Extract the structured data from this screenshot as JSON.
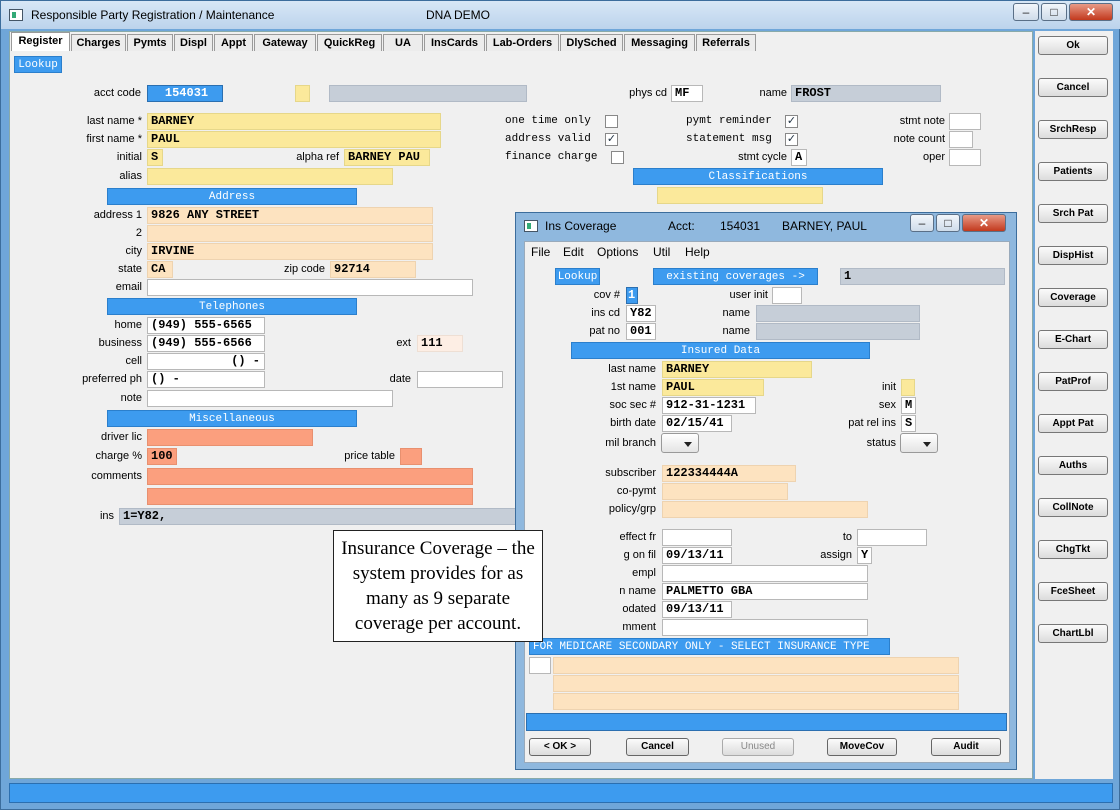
{
  "window": {
    "title": "Responsible Party Registration / Maintenance",
    "company": "DNA DEMO"
  },
  "tabs": [
    "Register",
    "Charges",
    "Pymts",
    "Displ",
    "Appt",
    "Gateway",
    "QuickReg",
    "UA",
    "InsCards",
    "Lab-Orders",
    "DlySched",
    "Messaging",
    "Referrals"
  ],
  "lookup_label": "Lookup",
  "account": {
    "acct_code_label": "acct code",
    "acct_code": "154031",
    "phys_cd_label": "phys cd",
    "phys_cd": "MF",
    "name_label": "name",
    "name": "FROST"
  },
  "patient": {
    "last_name_label": "last name *",
    "last_name": "BARNEY",
    "first_name_label": "first name *",
    "first_name": "PAUL",
    "initial_label": "initial",
    "initial": "S",
    "alpha_ref_label": "alpha ref",
    "alpha_ref": "BARNEY PAU",
    "alias_label": "alias",
    "alias": ""
  },
  "flags": {
    "one_time_only": "one time only",
    "address_valid": "address valid",
    "finance_charge": "finance charge",
    "pymt_reminder": "pymt reminder",
    "statement_msg": "statement msg",
    "stmt_cycle_label": "stmt cycle",
    "stmt_cycle": "A",
    "stmt_note_label": "stmt note",
    "note_count_label": "note count",
    "oper_label": "oper"
  },
  "sections": {
    "address": "Address",
    "telephones": "Telephones",
    "miscellaneous": "Miscellaneous",
    "classifications": "Classifications"
  },
  "address": {
    "address1_label": "address 1",
    "address1": "9826 ANY STREET",
    "address2_label": "2",
    "city_label": "city",
    "city": "IRVINE",
    "state_label": "state",
    "state": "CA",
    "zip_label": "zip code",
    "zip": "92714",
    "email_label": "email"
  },
  "phones": {
    "home_label": "home",
    "home": "(949) 555-6565",
    "business_label": "business",
    "business": "(949) 555-6566",
    "ext_label": "ext",
    "ext": "111",
    "cell_label": "cell",
    "cell": "() -",
    "preferred_label": "preferred ph",
    "preferred": "() -",
    "date_label": "date",
    "note_label": "note"
  },
  "misc": {
    "driver_lic_label": "driver lic",
    "charge_label": "charge %",
    "charge": "100",
    "price_table_label": "price table",
    "comments_label": "comments",
    "ins_label": "ins",
    "ins": "1=Y82,"
  },
  "side_buttons": [
    "Ok",
    "Cancel",
    "SrchResp",
    "Patients",
    "Srch Pat",
    "DispHist",
    "Coverage",
    "E-Chart",
    "PatProf",
    "Appt Pat",
    "Auths",
    "CollNote",
    "ChgTkt",
    "FceSheet",
    "ChartLbl"
  ],
  "ins_window": {
    "title": "Ins Coverage",
    "acct_label": "Acct:",
    "acct": "154031",
    "acct_name": "BARNEY, PAUL",
    "menu": [
      "File",
      "Edit",
      "Options",
      "Util",
      "Help"
    ],
    "lookup": "Lookup",
    "existing_coverages": "existing coverages ->",
    "existing_count": "1",
    "cov_label": "cov #",
    "cov": "1",
    "user_init_label": "user init",
    "ins_cd_label": "ins cd",
    "ins_cd": "Y82",
    "ins_name_label": "name",
    "pat_no_label": "pat no",
    "pat_no": "001",
    "pat_name_label": "name",
    "insured_data": "Insured Data",
    "last_name_label": "last name",
    "last_name": "BARNEY",
    "first_name_label": "1st name",
    "first_name": "PAUL",
    "init_label": "init",
    "soc_sec_label": "soc sec #",
    "soc_sec": "912-31-1231",
    "sex_label": "sex",
    "sex": "M",
    "birth_label": "birth date",
    "birth": "02/15/41",
    "pat_rel_label": "pat rel ins",
    "pat_rel": "S",
    "mil_branch_label": "mil branch",
    "status_label": "status",
    "subscriber_label": "subscriber",
    "subscriber": "122334444A",
    "co_pymt_label": "co-pymt",
    "policy_label": "policy/grp",
    "effect_label": "effect fr",
    "to_label": "to",
    "sig_on_file_label": "g on fil",
    "sig_on_file": "09/13/11",
    "assign_label": "assign",
    "assign": "Y",
    "empl_label": "empl",
    "plan_name_label": "n name",
    "plan_name": "PALMETTO GBA",
    "updated_label": "odated",
    "updated": "09/13/11",
    "comment_label": "mment",
    "medicare_header": "FOR MEDICARE SECONDARY ONLY - SELECT INSURANCE TYPE",
    "buttons": [
      "< OK >",
      "Cancel",
      "Unused",
      "MoveCov",
      "Audit"
    ]
  },
  "callout": "Insurance Coverage – the system provides for as many as 9 separate coverage per account."
}
